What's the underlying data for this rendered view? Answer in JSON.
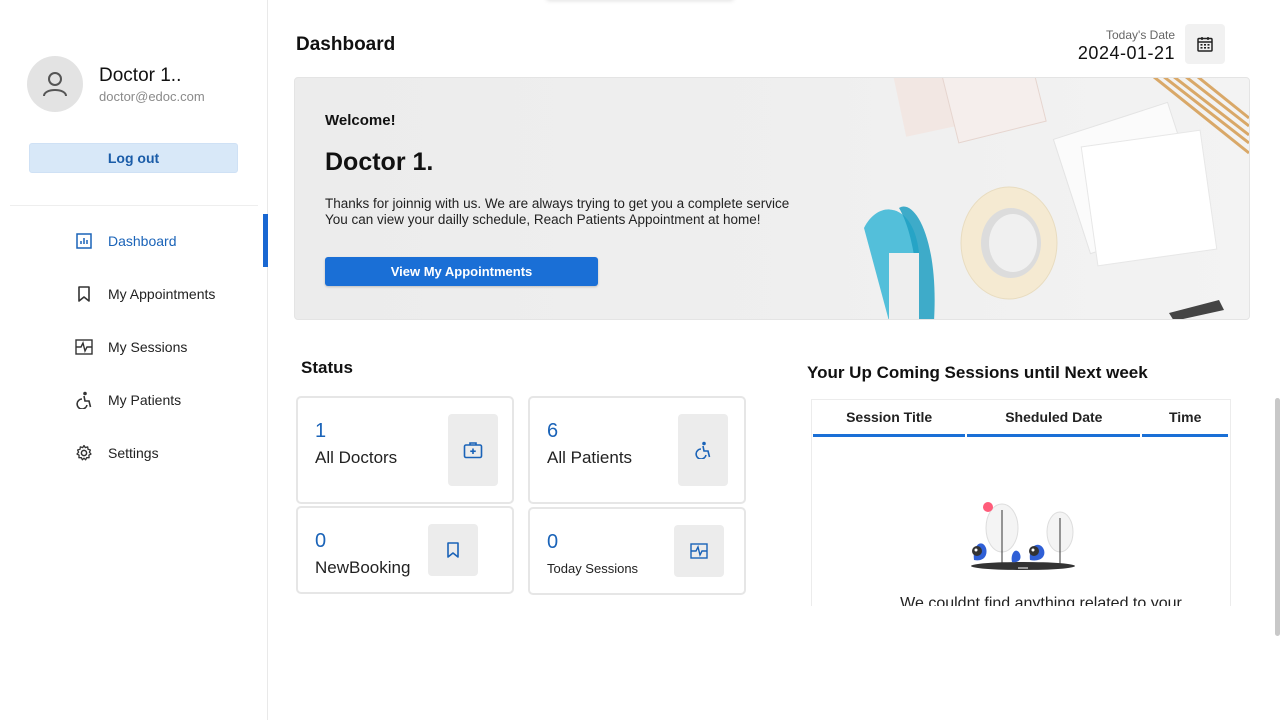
{
  "sidebar": {
    "profile": {
      "name": "Doctor 1..",
      "email": "doctor@edoc.com"
    },
    "logout_label": "Log out",
    "nav": [
      {
        "label": "Dashboard",
        "icon": "dashboard-icon",
        "active": true
      },
      {
        "label": "My Appointments",
        "icon": "bookmark-icon",
        "active": false
      },
      {
        "label": "My Sessions",
        "icon": "sessions-icon",
        "active": false
      },
      {
        "label": "My Patients",
        "icon": "wheelchair-icon",
        "active": false
      },
      {
        "label": "Settings",
        "icon": "gear-icon",
        "active": false
      }
    ]
  },
  "header": {
    "title": "Dashboard",
    "date_label": "Today's Date",
    "date_value": "2024-01-21"
  },
  "welcome": {
    "greeting": "Welcome!",
    "name": "Doctor 1.",
    "message_line1": "Thanks for joinnig with us. We are always trying to get you a complete service",
    "message_line2": "You can view your dailly schedule, Reach Patients Appointment at home!",
    "button_label": "View My Appointments"
  },
  "status": {
    "title": "Status",
    "cards": [
      {
        "value": "1",
        "label": "All Doctors",
        "icon": "doctor-kit-icon"
      },
      {
        "value": "6",
        "label": "All Patients",
        "icon": "wheelchair-icon"
      },
      {
        "value": "0",
        "label": "NewBooking",
        "icon": "bookmark-icon"
      },
      {
        "value": "0",
        "label": "Today Sessions",
        "icon": "sessions-icon"
      }
    ]
  },
  "upcoming": {
    "title": "Your Up Coming Sessions until Next week",
    "columns": [
      "Session Title",
      "Sheduled Date",
      "Time"
    ],
    "empty_text": "We couldnt find anything related to your"
  },
  "colors": {
    "accent": "#1a6fd6",
    "accent_text": "#1a63b8",
    "logout_bg": "#d8e8f8"
  }
}
